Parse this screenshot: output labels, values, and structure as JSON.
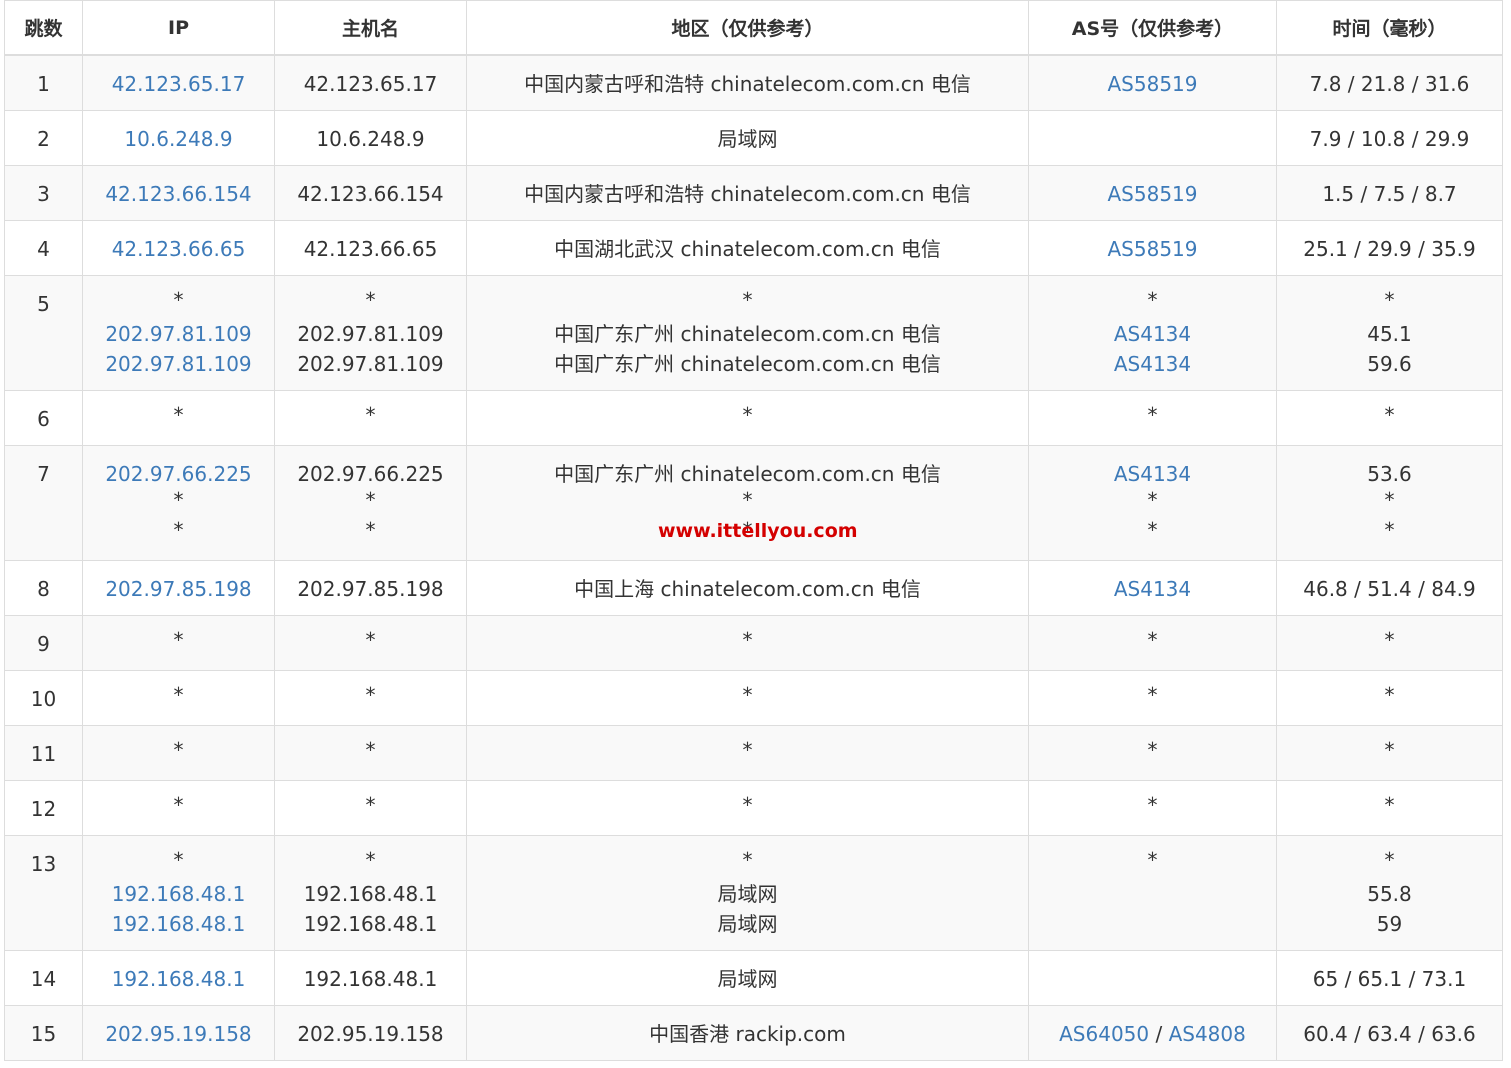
{
  "columns": [
    "跳数",
    "IP",
    "主机名",
    "地区（仅供参考）",
    "AS号（仅供参考）",
    "时间（毫秒）"
  ],
  "rows": [
    {
      "hop": "1",
      "ip": [
        "42.123.65.17"
      ],
      "host": [
        "42.123.65.17"
      ],
      "region": [
        "中国内蒙古呼和浩特 chinatelecom.com.cn 电信"
      ],
      "as": [
        [
          "AS58519"
        ]
      ],
      "time": [
        "7.8 / 21.8 / 31.6"
      ]
    },
    {
      "hop": "2",
      "ip": [
        "10.6.248.9"
      ],
      "host": [
        "10.6.248.9"
      ],
      "region": [
        "局域网"
      ],
      "as": [
        []
      ],
      "time": [
        "7.9 / 10.8 / 29.9"
      ]
    },
    {
      "hop": "3",
      "ip": [
        "42.123.66.154"
      ],
      "host": [
        "42.123.66.154"
      ],
      "region": [
        "中国内蒙古呼和浩特 chinatelecom.com.cn 电信"
      ],
      "as": [
        [
          "AS58519"
        ]
      ],
      "time": [
        "1.5 / 7.5 / 8.7"
      ]
    },
    {
      "hop": "4",
      "ip": [
        "42.123.66.65"
      ],
      "host": [
        "42.123.66.65"
      ],
      "region": [
        "中国湖北武汉 chinatelecom.com.cn 电信"
      ],
      "as": [
        [
          "AS58519"
        ]
      ],
      "time": [
        "25.1 / 29.9 / 35.9"
      ]
    },
    {
      "hop": "5",
      "ip": [
        "*",
        "202.97.81.109",
        "202.97.81.109"
      ],
      "host": [
        "*",
        "202.97.81.109",
        "202.97.81.109"
      ],
      "region": [
        "*",
        "中国广东广州 chinatelecom.com.cn 电信",
        "中国广东广州 chinatelecom.com.cn 电信"
      ],
      "as": [
        [
          "*"
        ],
        [
          "AS4134"
        ],
        [
          "AS4134"
        ]
      ],
      "time": [
        "*",
        "45.1",
        "59.6"
      ]
    },
    {
      "hop": "6",
      "ip": [
        "*"
      ],
      "host": [
        "*"
      ],
      "region": [
        "*"
      ],
      "as": [
        [
          "*"
        ]
      ],
      "time": [
        "*"
      ]
    },
    {
      "hop": "7",
      "ip": [
        "202.97.66.225",
        "*",
        "*"
      ],
      "host": [
        "202.97.66.225",
        "*",
        "*"
      ],
      "region": [
        "中国广东广州 chinatelecom.com.cn 电信",
        "*",
        "*"
      ],
      "as": [
        [
          "AS4134"
        ],
        [
          "*"
        ],
        [
          "*"
        ]
      ],
      "time": [
        "53.6",
        "*",
        "*"
      ]
    },
    {
      "hop": "8",
      "ip": [
        "202.97.85.198"
      ],
      "host": [
        "202.97.85.198"
      ],
      "region": [
        "中国上海 chinatelecom.com.cn 电信"
      ],
      "as": [
        [
          "AS4134"
        ]
      ],
      "time": [
        "46.8 / 51.4 / 84.9"
      ]
    },
    {
      "hop": "9",
      "ip": [
        "*"
      ],
      "host": [
        "*"
      ],
      "region": [
        "*"
      ],
      "as": [
        [
          "*"
        ]
      ],
      "time": [
        "*"
      ]
    },
    {
      "hop": "10",
      "ip": [
        "*"
      ],
      "host": [
        "*"
      ],
      "region": [
        "*"
      ],
      "as": [
        [
          "*"
        ]
      ],
      "time": [
        "*"
      ]
    },
    {
      "hop": "11",
      "ip": [
        "*"
      ],
      "host": [
        "*"
      ],
      "region": [
        "*"
      ],
      "as": [
        [
          "*"
        ]
      ],
      "time": [
        "*"
      ]
    },
    {
      "hop": "12",
      "ip": [
        "*"
      ],
      "host": [
        "*"
      ],
      "region": [
        "*"
      ],
      "as": [
        [
          "*"
        ]
      ],
      "time": [
        "*"
      ]
    },
    {
      "hop": "13",
      "ip": [
        "*",
        "192.168.48.1",
        "192.168.48.1"
      ],
      "host": [
        "*",
        "192.168.48.1",
        "192.168.48.1"
      ],
      "region": [
        "*",
        "局域网",
        "局域网"
      ],
      "as": [
        [
          "*"
        ],
        [],
        []
      ],
      "time": [
        "*",
        "55.8",
        "59"
      ]
    },
    {
      "hop": "14",
      "ip": [
        "192.168.48.1"
      ],
      "host": [
        "192.168.48.1"
      ],
      "region": [
        "局域网"
      ],
      "as": [
        []
      ],
      "time": [
        "65 / 65.1 / 73.1"
      ]
    },
    {
      "hop": "15",
      "ip": [
        "202.95.19.158"
      ],
      "host": [
        "202.95.19.158"
      ],
      "region": [
        "中国香港 rackip.com"
      ],
      "as": [
        [
          "AS64050",
          "AS4808"
        ]
      ],
      "time": [
        "60.4 / 63.4 / 63.6"
      ]
    }
  ],
  "as_separator": " / ",
  "watermark": "www.ittellyou.com",
  "colors": {
    "link": "#3d7ab8",
    "stripe": "#f9f9f9",
    "border": "#dddddd",
    "watermark": "#d40000"
  }
}
